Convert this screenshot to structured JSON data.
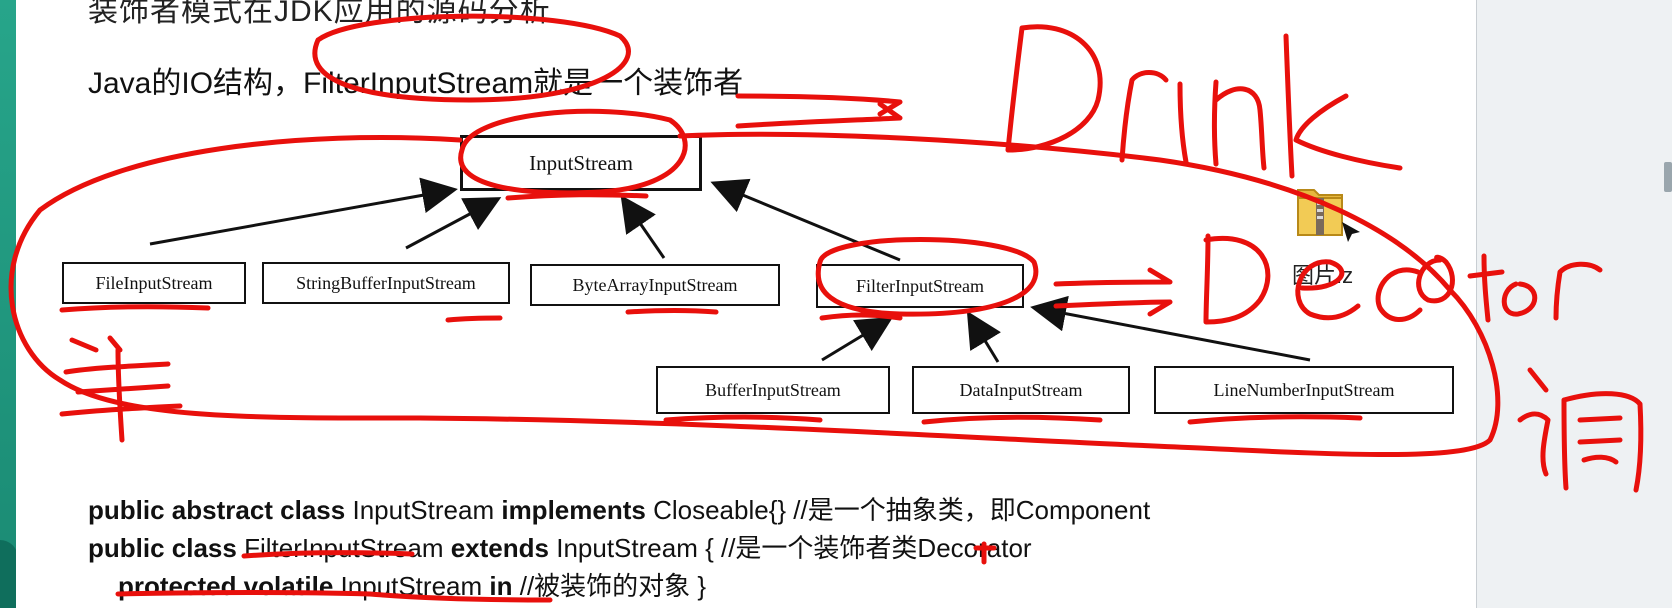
{
  "slide": {
    "top_text": "装饰者模式在JDK应用的源码分析",
    "heading": "Java的IO结构，FilterInputStream就是一个装饰者"
  },
  "diagram": {
    "root": "InputStream",
    "level1": [
      "FileInputStream",
      "StringBufferInputStream",
      "ByteArrayInputStream",
      "FilterInputStream"
    ],
    "level2": [
      "BufferInputStream",
      "DataInputStream",
      "LineNumberInputStream"
    ]
  },
  "code": {
    "line1": {
      "kw1": "public abstract class",
      "name1": "InputStream",
      "kw2": "implements",
      "rest": "Closeable{} //是一个抽象类，即Component"
    },
    "line2": {
      "kw1": "public class",
      "name1": "FilterInputStream",
      "kw2": "extends",
      "rest": "InputStream { //是一个装饰者类Decorator"
    },
    "line3": {
      "kw1": "protected volatile",
      "name1": "InputStream",
      "kw2": "in",
      "rest": "//被装饰的对象 }"
    }
  },
  "desktop": {
    "icon": "folder-zip-icon",
    "label": "图片.z"
  },
  "annotations": {
    "handwriting": [
      "Drink",
      "Decorator",
      "调",
      "单"
    ],
    "ink_color": "#e8100c"
  }
}
